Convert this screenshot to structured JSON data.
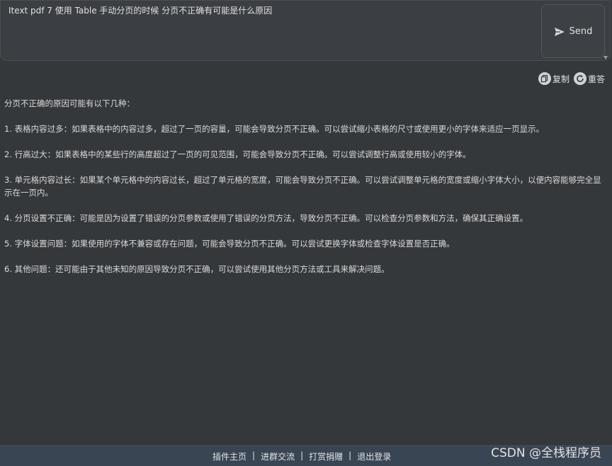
{
  "prompt": {
    "text": "Itext pdf 7 使用 Table 手动分页的时候 分页不正确有可能是什么原因"
  },
  "send_button": {
    "label": "Send",
    "icon": "send-icon"
  },
  "actions": [
    {
      "label": "复制",
      "icon": "copy-icon"
    },
    {
      "label": "重答",
      "icon": "refresh-icon"
    }
  ],
  "answer": {
    "intro": "分页不正确的原因可能有以下几种：",
    "items": [
      "1. 表格内容过多：如果表格中的内容过多，超过了一页的容量，可能会导致分页不正确。可以尝试缩小表格的尺寸或使用更小的字体来适应一页显示。",
      "2. 行高过大：如果表格中的某些行的高度超过了一页的可见范围，可能会导致分页不正确。可以尝试调整行高或使用较小的字体。",
      "3. 单元格内容过长：如果某个单元格中的内容过长，超过了单元格的宽度，可能会导致分页不正确。可以尝试调整单元格的宽度或缩小字体大小，以便内容能够完全显示在一页内。",
      "4. 分页设置不正确：可能是因为设置了错误的分页参数或使用了错误的分页方法，导致分页不正确。可以检查分页参数和方法，确保其正确设置。",
      "5. 字体设置问题：如果使用的字体不兼容或存在问题，可能会导致分页不正确。可以尝试更换字体或检查字体设置是否正确。",
      "6. 其他问题：还可能由于其他未知的原因导致分页不正确，可以尝试使用其他分页方法或工具来解决问题。"
    ]
  },
  "footer": {
    "links": [
      "插件主页",
      "进群交流",
      "打赏捐赠",
      "退出登录"
    ],
    "separator": "|"
  },
  "watermark": "CSDN @全栈程序员"
}
